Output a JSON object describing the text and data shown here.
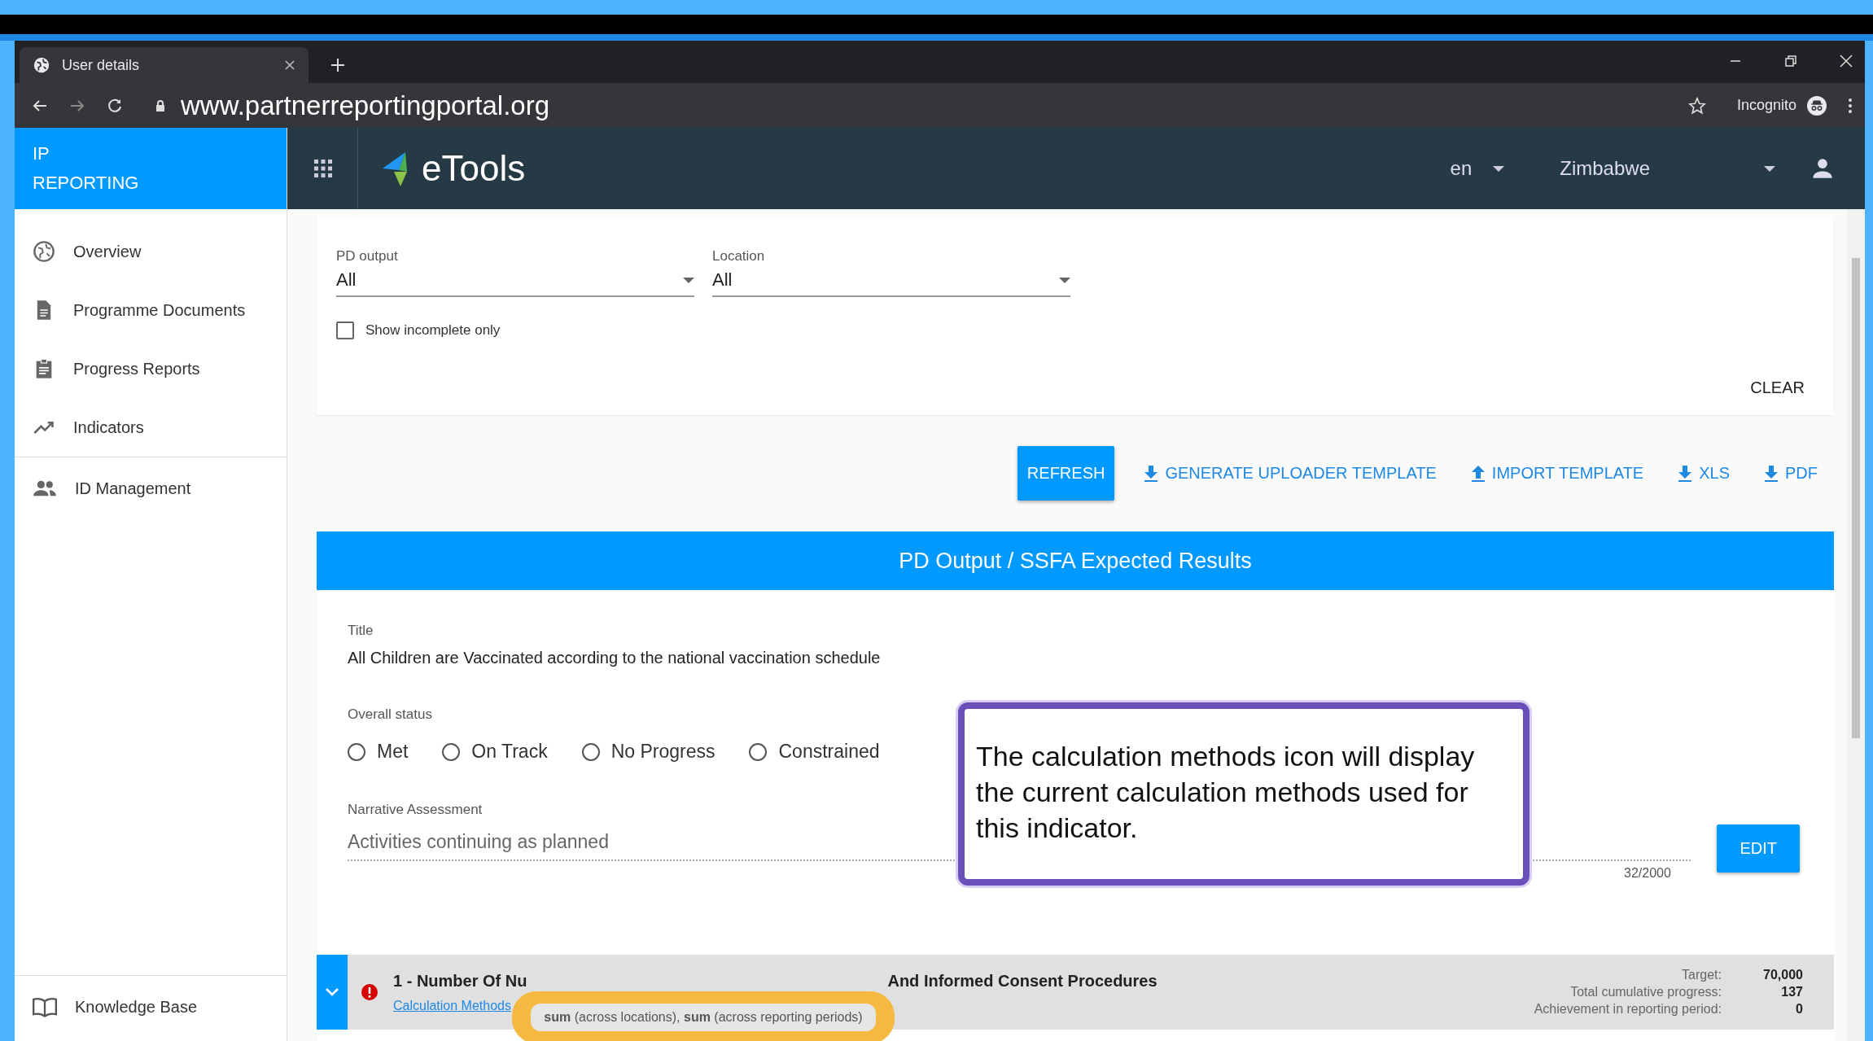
{
  "browser": {
    "tab_title": "User details",
    "url": "www.partnerreportingportal.org",
    "profile_label": "Incognito"
  },
  "header": {
    "brand_lines": [
      "IP",
      "REPORTING"
    ],
    "logo_text": "eTools",
    "language": "en",
    "country": "Zimbabwe"
  },
  "sidebar": {
    "items": [
      {
        "label": "Overview"
      },
      {
        "label": "Programme Documents"
      },
      {
        "label": "Progress Reports"
      },
      {
        "label": "Indicators"
      },
      {
        "label": "ID Management"
      }
    ],
    "footer_item": "Knowledge Base"
  },
  "filters": {
    "fields": [
      {
        "label": "PD output",
        "value": "All"
      },
      {
        "label": "Location",
        "value": "All"
      }
    ],
    "checkbox": {
      "label": "Show incomplete only",
      "checked": false
    },
    "clear_button": "CLEAR"
  },
  "actions": [
    {
      "label": "REFRESH",
      "kind": "raised"
    },
    {
      "label": "GENERATE UPLOADER TEMPLATE",
      "kind": "download"
    },
    {
      "label": "IMPORT TEMPLATE",
      "kind": "upload"
    },
    {
      "label": "XLS",
      "kind": "download"
    },
    {
      "label": "PDF",
      "kind": "download"
    }
  ],
  "section": {
    "header": "PD Output / SSFA Expected Results",
    "title_label": "Title",
    "title": "All Children are Vaccinated according to the national vaccination schedule",
    "status_label": "Overall status",
    "statuses": [
      {
        "label": "Met",
        "selected": false
      },
      {
        "label": "On Track",
        "selected": false
      },
      {
        "label": "No Progress",
        "selected": false
      },
      {
        "label": "Constrained",
        "selected": false
      }
    ],
    "narrative_label": "Narrative Assessment",
    "narrative": "Activities continuing as planned",
    "char_count": "32/2000",
    "edit_button": "EDIT"
  },
  "callout": {
    "text": "The calculation methods icon will display the current calculation methods used for this indicator."
  },
  "indicator": {
    "expanded": true,
    "title_start": "1 - Number Of Nu",
    "title_end": "And Informed Consent Procedures",
    "link": "Calculation Methods",
    "tooltip": "**sum** (across locations), **sum** (across reporting periods)",
    "stats": [
      {
        "label": "Target:",
        "value": "70,000"
      },
      {
        "label": "Total cumulative progress:",
        "value": "137"
      },
      {
        "label": "Achievement in reporting period:",
        "value": "0"
      }
    ]
  }
}
